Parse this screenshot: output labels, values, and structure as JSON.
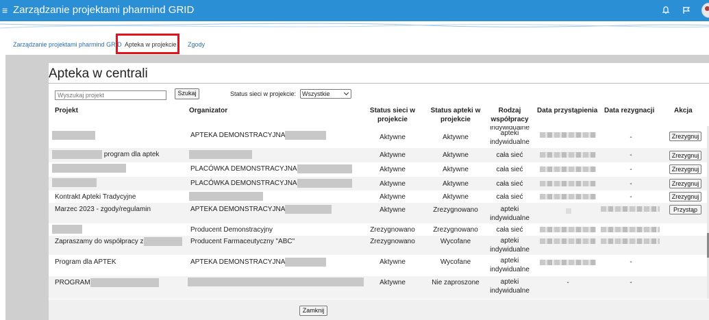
{
  "app": {
    "title": "Zarządzanie projektami pharmind GRID"
  },
  "icons": {
    "menu": "hamburger-icon",
    "notifications": "bell-icon",
    "flag": "flag-icon",
    "user": "user-avatar-icon"
  },
  "colors": {
    "appbar": "#2b8fd6",
    "tab_highlight": "#e0141a",
    "link": "#2b6fb0"
  },
  "tabs": [
    {
      "label": "Zarządzanie projektami pharmind GRID"
    },
    {
      "label": "Apteka w projekcie",
      "highlighted": true
    },
    {
      "label": "Zgody"
    }
  ],
  "panel": {
    "title": "Apteka w centrali",
    "search": {
      "placeholder": "Wyszukaj projekt",
      "value": "",
      "button": "Szukaj"
    },
    "status_filter": {
      "label": "Status sieci w projekcie:",
      "selected": "Wszystkie"
    },
    "columns": [
      "Projekt",
      "Organizator",
      "Status sieci w projekcie",
      "Status apteki w projekcie",
      "Rodzaj współpracy",
      "Data przystąpienia",
      "Data rezygnacji",
      "Akcja"
    ],
    "partial_top_row": {
      "rodzaj": "indywidualne"
    },
    "rows": [
      {
        "projekt": "",
        "organizator": "APTEKA DEMONSTRACYJNA",
        "status_sieci": "Aktywne",
        "status_apteki": "Aktywne",
        "rodzaj": [
          "apteki",
          "indywidualne"
        ],
        "data_rezygnacji": "-",
        "akcja": "Zrezygnuj"
      },
      {
        "projekt": "program dla aptek",
        "organizator": "",
        "status_sieci": "Aktywne",
        "status_apteki": "Aktywne",
        "rodzaj": [
          "cała sieć"
        ],
        "data_rezygnacji": "-",
        "akcja": "Zrezygnuj"
      },
      {
        "projekt": "",
        "organizator": "PLACÓWKA DEMONSTRACYJNA",
        "status_sieci": "Aktywne",
        "status_apteki": "Aktywne",
        "rodzaj": [
          "cała sieć"
        ],
        "data_rezygnacji": "-",
        "akcja": "Zrezygnuj"
      },
      {
        "projekt": "",
        "organizator": "PLACÓWKA DEMONSTRACYJNA",
        "status_sieci": "Aktywne",
        "status_apteki": "Aktywne",
        "rodzaj": [
          "cała sieć"
        ],
        "data_rezygnacji": "-",
        "akcja": "Zrezygnuj"
      },
      {
        "projekt": "Kontrakt Apteki Tradycyjne",
        "organizator": "",
        "status_sieci": "Aktywne",
        "status_apteki": "Aktywne",
        "rodzaj": [
          "cała sieć"
        ],
        "data_rezygnacji": "-",
        "akcja": "Zrezygnuj"
      },
      {
        "projekt": "Marzec 2023 - zgody/regulamin",
        "organizator": "APTEKA DEMONSTRACYJNA",
        "status_sieci": "Aktywne",
        "status_apteki": "Zrezygnowano",
        "rodzaj": [
          "apteki",
          "indywidualne"
        ],
        "data_rezygnacji": "",
        "akcja": "Przystąp"
      },
      {
        "projekt": "",
        "organizator": "Producent Demonstracyjny",
        "status_sieci": "Zrezygnowano",
        "status_apteki": "Zrezygnowano",
        "rodzaj": [
          "cała sieć"
        ],
        "data_rezygnacji": "",
        "akcja": ""
      },
      {
        "projekt": "Zapraszamy do współpracy z",
        "organizator": "Producent Farmaceutyczny \"ABC\"",
        "status_sieci": "Zrezygnowano",
        "status_apteki": "Wycofane",
        "rodzaj": [
          "apteki",
          "indywidualne"
        ],
        "data_rezygnacji": "",
        "akcja": ""
      },
      {
        "projekt": "Program dla APTEK",
        "organizator": "APTEKA DEMONSTRACYJNA",
        "status_sieci": "Aktywne",
        "status_apteki": "Wycofane",
        "rodzaj": [
          "apteki",
          "indywidualne"
        ],
        "data_rezygnacji": "-",
        "akcja": ""
      },
      {
        "projekt": "PROGRAM",
        "organizator": "",
        "status_sieci": "Aktywne",
        "status_apteki": "Nie zaproszone",
        "rodzaj": [
          "apteki",
          "indywidualne"
        ],
        "data_przystapienia": "-",
        "data_rezygnacji": "-",
        "akcja": ""
      }
    ],
    "close_button": "Zamknij"
  }
}
